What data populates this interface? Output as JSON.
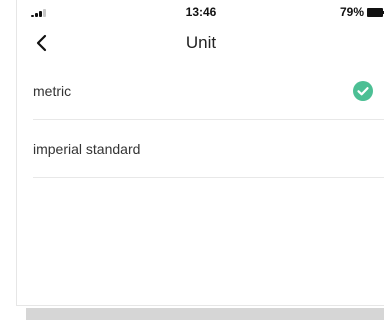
{
  "status_bar": {
    "time": "13:46",
    "battery_percent": "79%",
    "signal_icon": "signal-bars-icon",
    "battery_icon": "battery-icon"
  },
  "nav": {
    "title": "Unit",
    "back_icon": "chevron-left-icon"
  },
  "units": {
    "items": [
      {
        "label": "metric",
        "selected": true
      },
      {
        "label": "imperial standard",
        "selected": false
      }
    ]
  },
  "colors": {
    "accent": "#4cbf94",
    "divider": "#e8e8e8",
    "text_primary": "#333333"
  }
}
